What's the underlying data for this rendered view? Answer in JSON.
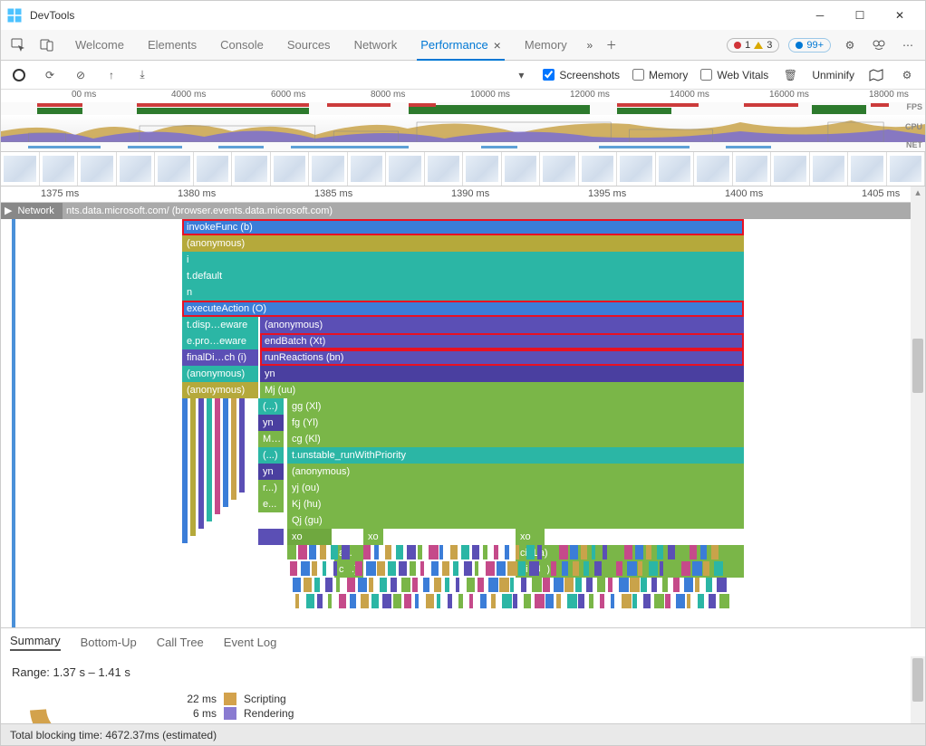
{
  "window": {
    "title": "DevTools"
  },
  "tabs": {
    "items": [
      "Welcome",
      "Elements",
      "Console",
      "Sources",
      "Network",
      "Performance",
      "Memory"
    ],
    "active": "Performance",
    "errors_badge": "1",
    "warnings_badge": "3",
    "messages_badge": "99+"
  },
  "perfbar": {
    "screenshots": "Screenshots",
    "memory": "Memory",
    "webvitals": "Web Vitals",
    "unminify": "Unminify"
  },
  "overview_ruler": [
    "00 ms",
    "4000 ms",
    "6000 ms",
    "8000 ms",
    "10000 ms",
    "12000 ms",
    "14000 ms",
    "16000 ms",
    "18000 ms"
  ],
  "overview_labels": {
    "fps": "FPS",
    "cpu": "CPU",
    "net": "NET"
  },
  "detail_ruler": [
    "1375 ms",
    "1380 ms",
    "1385 ms",
    "1390 ms",
    "1395 ms",
    "1400 ms",
    "1405 ms"
  ],
  "network_track": {
    "label": "Network",
    "resource": "nts.data.microsoft.com/ (browser.events.data.microsoft.com)"
  },
  "flame": [
    {
      "l": 200,
      "r": 820,
      "c": "c-blue1",
      "t": "invokeFunc (b)",
      "hl": true
    },
    {
      "l": 200,
      "r": 820,
      "c": "c-olive",
      "t": "(anonymous)"
    },
    {
      "l": 200,
      "r": 820,
      "c": "c-teal",
      "t": "i"
    },
    {
      "l": 200,
      "r": 820,
      "c": "c-teal",
      "t": "t.default"
    },
    {
      "l": 200,
      "r": 820,
      "c": "c-teal",
      "t": "n"
    },
    {
      "l": 200,
      "r": 820,
      "c": "c-blue1",
      "t": "executeAction (O)",
      "hl": true
    },
    [
      {
        "l": 200,
        "r": 284,
        "c": "c-teal",
        "t": "t.disp…eware"
      },
      {
        "l": 286,
        "r": 820,
        "c": "c-purple",
        "t": "(anonymous)"
      }
    ],
    [
      {
        "l": 200,
        "r": 284,
        "c": "c-teal",
        "t": "e.pro…eware"
      },
      {
        "l": 286,
        "r": 820,
        "c": "c-purple",
        "t": "endBatch (Xt)",
        "hl": true
      }
    ],
    [
      {
        "l": 200,
        "r": 284,
        "c": "c-purple",
        "t": "finalDi…ch (i)"
      },
      {
        "l": 286,
        "r": 820,
        "c": "c-purple",
        "t": "runReactions (bn)",
        "hl": true
      }
    ],
    [
      {
        "l": 200,
        "r": 284,
        "c": "c-teal",
        "t": "(anonymous)"
      },
      {
        "l": 286,
        "r": 820,
        "c": "c-purple2",
        "t": "yn"
      }
    ],
    [
      {
        "l": 200,
        "r": 284,
        "c": "c-olive",
        "t": "(anonymous)"
      },
      {
        "l": 286,
        "r": 820,
        "c": "c-green",
        "t": "Mj (uu)"
      }
    ],
    [
      {
        "l": 284,
        "r": 312,
        "c": "c-teal",
        "t": "(...)"
      },
      {
        "l": 316,
        "r": 820,
        "c": "c-green",
        "t": "gg (Xl)"
      }
    ],
    [
      {
        "l": 284,
        "r": 312,
        "c": "c-purple2",
        "t": "yn"
      },
      {
        "l": 316,
        "r": 820,
        "c": "c-green",
        "t": "fg (Yl)"
      }
    ],
    [
      {
        "l": 284,
        "r": 312,
        "c": "c-green",
        "t": "M..."
      },
      {
        "l": 316,
        "r": 820,
        "c": "c-green",
        "t": "cg (Kl)"
      }
    ],
    [
      {
        "l": 284,
        "r": 312,
        "c": "c-teal",
        "t": "(...)"
      },
      {
        "l": 316,
        "r": 820,
        "c": "c-teal",
        "t": "t.unstable_runWithPriority"
      }
    ],
    [
      {
        "l": 284,
        "r": 312,
        "c": "c-purple2",
        "t": "yn"
      },
      {
        "l": 316,
        "r": 820,
        "c": "c-green",
        "t": "(anonymous)"
      }
    ],
    [
      {
        "l": 284,
        "r": 312,
        "c": "c-green",
        "t": "r...)"
      },
      {
        "l": 316,
        "r": 820,
        "c": "c-green",
        "t": "yj (ou)"
      }
    ],
    [
      {
        "l": 284,
        "r": 312,
        "c": "c-green",
        "t": "e..."
      },
      {
        "l": 316,
        "r": 820,
        "c": "c-green",
        "t": "Kj (hu)"
      }
    ],
    [
      {
        "l": 316,
        "r": 820,
        "c": "c-green",
        "t": "Qj (gu)"
      }
    ],
    [
      {
        "l": 316,
        "r": 365,
        "c": "c-green2",
        "t": "xo"
      },
      {
        "l": 400,
        "r": 422,
        "c": "c-green",
        "t": "xo"
      },
      {
        "l": 568,
        "r": 600,
        "c": "c-green",
        "t": "xo"
      }
    ],
    [
      {
        "l": 368,
        "r": 400,
        "c": "c-green",
        "t": "ai...)"
      },
      {
        "l": 568,
        "r": 820,
        "c": "c-green",
        "t": "ci (La)"
      }
    ],
    [
      {
        "l": 368,
        "r": 400,
        "c": "c-green",
        "t": "ci...)"
      },
      {
        "l": 568,
        "r": 820,
        "c": "c-green",
        "t": "di (Ua)"
      }
    ]
  ],
  "bottom_tabs": [
    "Summary",
    "Bottom-Up",
    "Call Tree",
    "Event Log"
  ],
  "summary": {
    "range": "Range: 1.37 s – 1.41 s",
    "legend": [
      {
        "ms": "22 ms",
        "label": "Scripting",
        "color": "#d3a24c"
      },
      {
        "ms": "6 ms",
        "label": "Rendering",
        "color": "#8a7bd1"
      }
    ]
  },
  "status": "Total blocking time: 4672.37ms (estimated)"
}
